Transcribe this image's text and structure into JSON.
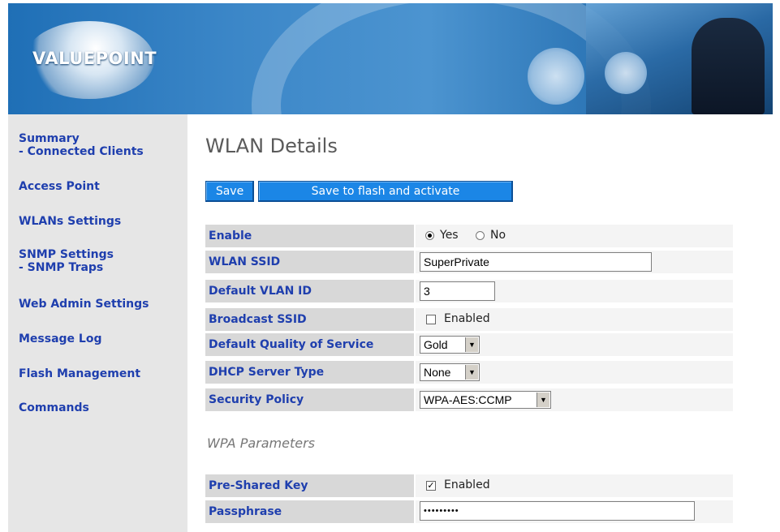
{
  "banner": {
    "logo_text": "VALUEPOINT"
  },
  "sidebar": {
    "items": [
      {
        "label": "Summary",
        "sub": "- Connected Clients"
      },
      {
        "label": "Access Point"
      },
      {
        "label": "WLANs Settings"
      },
      {
        "label": "SNMP Settings",
        "sub": "- SNMP Traps"
      },
      {
        "label": "Web Admin Settings"
      },
      {
        "label": "Message Log"
      },
      {
        "label": "Flash Management"
      },
      {
        "label": "Commands"
      }
    ]
  },
  "main": {
    "title": "WLAN Details",
    "buttons": {
      "save": "Save",
      "save_flash": "Save to flash and activate"
    },
    "rows": {
      "enable": {
        "label": "Enable",
        "yes": "Yes",
        "no": "No",
        "selected": "Yes"
      },
      "ssid": {
        "label": "WLAN SSID",
        "value": "SuperPrivate"
      },
      "vlan": {
        "label": "Default VLAN ID",
        "value": "3"
      },
      "broadcast": {
        "label": "Broadcast SSID",
        "checkbox_label": "Enabled",
        "checked": false
      },
      "qos": {
        "label": "Default Quality of Service",
        "value": "Gold"
      },
      "dhcp": {
        "label": "DHCP Server Type",
        "value": "None"
      },
      "security": {
        "label": "Security Policy",
        "value": "WPA-AES:CCMP"
      }
    },
    "wpa_section": {
      "title": "WPA Parameters",
      "psk": {
        "label": "Pre-Shared Key",
        "checkbox_label": "Enabled",
        "checked": true
      },
      "passphrase": {
        "label": "Passphrase",
        "value": "•••••••••"
      }
    }
  },
  "colors": {
    "nav_link": "#1f3fae",
    "button": "#1b86e6",
    "label_bg": "#d8d8d8",
    "sidebar_bg": "#e6e6e6"
  }
}
